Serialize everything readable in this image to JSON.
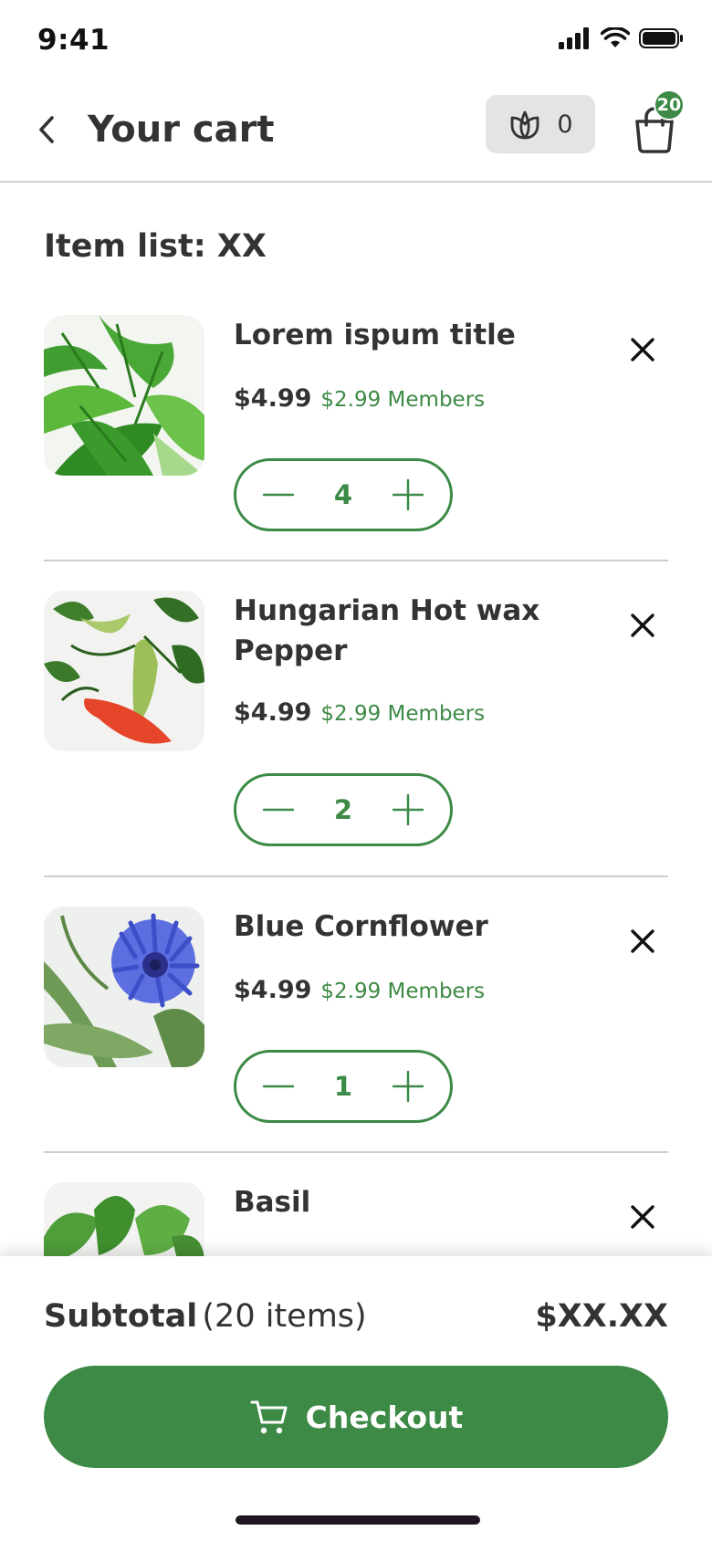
{
  "status_bar": {
    "time": "9:41"
  },
  "header": {
    "title": "Your cart",
    "points_count": "0",
    "bag_badge": "20",
    "back_icon": "chevron-left-icon",
    "points_icon": "leaf-icon",
    "bag_icon": "shopping-bag-icon"
  },
  "list": {
    "heading": "Item list: XX",
    "items": [
      {
        "name": "Lorem ispum title",
        "price": "$4.99",
        "member_price": "$2.99 Members",
        "quantity": "4"
      },
      {
        "name": "Hungarian Hot wax Pepper",
        "price": "$4.99",
        "member_price": "$2.99 Members",
        "quantity": "2"
      },
      {
        "name": "Blue Cornflower",
        "price": "$4.99",
        "member_price": "$2.99 Members",
        "quantity": "1"
      },
      {
        "name": "Basil",
        "price": "",
        "member_price": "",
        "quantity": ""
      }
    ]
  },
  "footer": {
    "subtotal_label": "Subtotal",
    "subtotal_count": "(20 items)",
    "subtotal_value": "$XX.XX",
    "checkout_label": "Checkout"
  },
  "colors": {
    "accent": "#3c8a45",
    "text": "#333333",
    "divider": "#cdcdcd",
    "chip": "#e4e4e4"
  }
}
